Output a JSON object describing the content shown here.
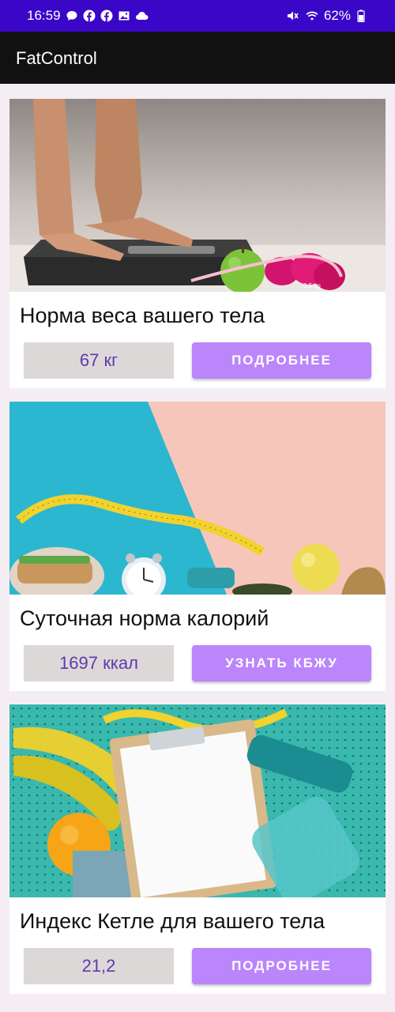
{
  "status_bar": {
    "time": "16:59",
    "battery": "62%",
    "bg_color": "#3a07c9",
    "left_icons": [
      "message-icon",
      "facebook-icon",
      "facebook-icon",
      "gallery-icon",
      "cloud-icon"
    ],
    "right_icons": [
      "mute-icon",
      "wifi-icon",
      "battery-icon"
    ]
  },
  "app_bar": {
    "title": "FatControl",
    "bg_color": "#111111"
  },
  "cards": [
    {
      "title": "Норма веса вашего тела",
      "value": "67 кг",
      "button_label": "ПОДРОБНЕЕ",
      "image": "scale-feet-image"
    },
    {
      "title": "Суточная норма калорий",
      "value": "1697 ккал",
      "button_label": "УЗНАТЬ КБЖУ",
      "image": "fitness-food-image"
    },
    {
      "title": "Индекс Кетле для вашего тела",
      "value": "21,2",
      "button_label": "ПОДРОБНЕЕ",
      "image": "clipboard-fruit-image"
    }
  ],
  "colors": {
    "accent": "#bb86fc",
    "value_text": "#5c3ab0",
    "value_bg": "#ddd8d8",
    "page_bg": "#f4eef4"
  }
}
